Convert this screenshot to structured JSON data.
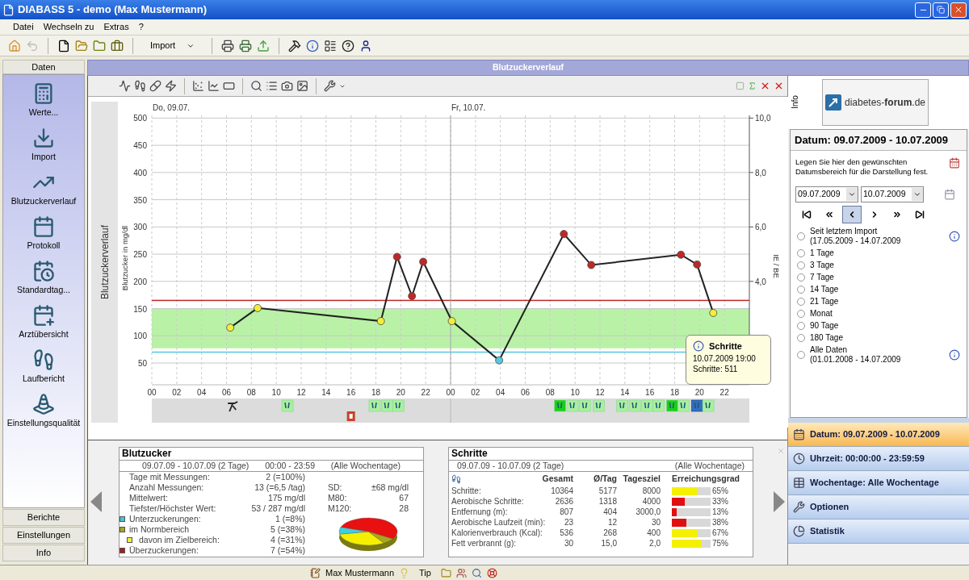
{
  "window": {
    "title": "DIABASS 5 - demo (Max Mustermann)"
  },
  "menu": [
    "Datei",
    "Wechseln zu",
    "Extras",
    "?"
  ],
  "toolbar": {
    "import_label": "Import"
  },
  "sidebar": {
    "header": "Daten",
    "items": [
      {
        "label": "Werte..."
      },
      {
        "label": "Import"
      },
      {
        "label": "Blutzuckerverlauf"
      },
      {
        "label": "Protokoll"
      },
      {
        "label": "Standardtag..."
      },
      {
        "label": "Arztübersicht"
      },
      {
        "label": "Laufbericht"
      },
      {
        "label": "Einstellungsqualität"
      }
    ],
    "sections": [
      "Berichte",
      "Einstellungen",
      "Info"
    ]
  },
  "panel": {
    "title": "Blutzuckerverlauf",
    "side_title": "Blutzuckerverlauf",
    "day_labels": [
      "Do, 09.07.",
      "Fr, 10.07."
    ],
    "chart_data": {
      "type": "line",
      "ylabel": "Blutzucker in mg/dl",
      "x": [
        6.3,
        8.5,
        18.4,
        19.7,
        20.9,
        21.8,
        24.1,
        27.9,
        33.1,
        35.3,
        42.5,
        43.8,
        45.1
      ],
      "series": [
        {
          "color": "#222222",
          "marker": "circle",
          "values": [
            115,
            151,
            127,
            245,
            173,
            236,
            127,
            55,
            287,
            230,
            249,
            231,
            142
          ]
        }
      ],
      "xlim": [
        0,
        48
      ],
      "ylim": [
        10,
        505
      ],
      "xticks": [
        {
          "value": 0,
          "label": "00"
        },
        {
          "value": 2,
          "label": "02"
        },
        {
          "value": 4,
          "label": "04"
        },
        {
          "value": 6,
          "label": "06"
        },
        {
          "value": 8,
          "label": "08"
        },
        {
          "value": 10,
          "label": "10"
        },
        {
          "value": 12,
          "label": "12"
        },
        {
          "value": 14,
          "label": "14"
        },
        {
          "value": 16,
          "label": "16"
        },
        {
          "value": 18,
          "label": "18"
        },
        {
          "value": 20,
          "label": "20"
        },
        {
          "value": 22,
          "label": "22"
        },
        {
          "value": 24,
          "label": "00"
        },
        {
          "value": 26,
          "label": "02"
        },
        {
          "value": 28,
          "label": "04"
        },
        {
          "value": 30,
          "label": "06"
        },
        {
          "value": 32,
          "label": "08"
        },
        {
          "value": 34,
          "label": "10"
        },
        {
          "value": 36,
          "label": "12"
        },
        {
          "value": 38,
          "label": "14"
        },
        {
          "value": 40,
          "label": "16"
        },
        {
          "value": 42,
          "label": "18"
        },
        {
          "value": 44,
          "label": "20"
        },
        {
          "value": 46,
          "label": "22"
        }
      ],
      "yticks": [
        50,
        100,
        150,
        200,
        250,
        300,
        350,
        400,
        450,
        500
      ],
      "y2label": "IE / BE",
      "y2lim": [
        0.2,
        10.1
      ],
      "y2ticks": [
        {
          "value": 4,
          "label": "4,0"
        },
        {
          "value": 6,
          "label": "6,0"
        },
        {
          "value": 8,
          "label": "8,0"
        },
        {
          "value": 10,
          "label": "10,0"
        }
      ],
      "grid": true,
      "bands": [
        {
          "axis": "y",
          "from": 77,
          "to": 150,
          "color": "#b9f2a6"
        }
      ],
      "ref_lines": [
        {
          "axis": "y",
          "value": 165,
          "color": "#c02828"
        },
        {
          "axis": "y",
          "value": 70,
          "color": "#55c8e4"
        },
        {
          "axis": "x",
          "value": 24,
          "color": "#a8a8a8"
        }
      ]
    },
    "tooltip": {
      "title": "Schritte",
      "lines": [
        "10.07.2009 19:00",
        "Schritte: 511"
      ]
    }
  },
  "blutzucker": {
    "title": "Blutzucker",
    "period": [
      "09.07.09 - 10.07.09 (2 Tage)",
      "00:00 - 23:59",
      "(Alle Wochentage)"
    ],
    "stats": [
      {
        "label": "Tage mit Messungen:",
        "value": "2 (=100%)"
      },
      {
        "label": "Anzahl Messungen:",
        "value": "13 (=6,5 /tag)"
      },
      {
        "label": "Mittelwert:",
        "value": "175 mg/dl"
      },
      {
        "label": "Tiefster/Höchster Wert:",
        "value": "53 / 287 mg/dl"
      }
    ],
    "extra": [
      {
        "label": "SD:",
        "value": "±68 mg/dl"
      },
      {
        "label": "M80:",
        "value": "67"
      },
      {
        "label": "M120:",
        "value": "28"
      }
    ],
    "legend": [
      {
        "label": "Unterzuckerungen:",
        "value": "1 (=8%)",
        "color": "#3cc8d8"
      },
      {
        "label": "im Normbereich",
        "value": "5 (=38%)",
        "color": "#a8a818",
        "children": [
          {
            "label": "davon im Zielbereich:",
            "value": "4 (=31%)",
            "color": "#f0f040"
          }
        ]
      },
      {
        "label": "Überzuckerungen:",
        "value": "7 (=54%)",
        "color": "#b01818"
      }
    ]
  },
  "schritte": {
    "title": "Schritte",
    "period": [
      "09.07.09 - 10.07.09 (2 Tage)",
      "(Alle Wochentage)"
    ],
    "columns": [
      "Gesamt",
      "Ø/Tag",
      "Tagesziel",
      "Erreichungsgrad"
    ],
    "rows": [
      {
        "label": "Schritte:",
        "values": [
          "10364",
          "5177",
          "8000"
        ],
        "level": 0.65,
        "color": "#f5f000",
        "percent": "65%"
      },
      {
        "label": "Aerobische Schritte:",
        "values": [
          "2636",
          "1318",
          "4000"
        ],
        "level": 0.33,
        "color": "#e01010",
        "percent": "33%"
      },
      {
        "label": "Entfernung (m):",
        "values": [
          "807",
          "404",
          "3000,0"
        ],
        "level": 0.13,
        "color": "#e01010",
        "percent": "13%"
      },
      {
        "label": "Aerobische Laufzeit (min):",
        "values": [
          "23",
          "12",
          "30"
        ],
        "level": 0.38,
        "color": "#e01010",
        "percent": "38%"
      },
      {
        "label": "Kalorienverbrauch (Kcal):",
        "values": [
          "536",
          "268",
          "400"
        ],
        "level": 0.67,
        "color": "#f5f000",
        "percent": "67%"
      },
      {
        "label": "Fett verbrannt (g):",
        "values": [
          "30",
          "15,0",
          "2,0"
        ],
        "level": 0.75,
        "color": "#f5f000",
        "percent": "75%"
      }
    ]
  },
  "date_panel": {
    "tab": "Info",
    "logo": "diabetes-**forum**.de",
    "title": "Datum: 09.07.2009 - 10.07.2009",
    "hint": "Legen Sie hier den gewünschten Datumsbereich für die Darstellung fest.",
    "from": "09.07.2009",
    "to": "10.07.2009",
    "nav": [
      {
        "selected": false
      },
      {
        "selected": false
      },
      {
        "selected": true
      },
      {
        "selected": false
      },
      {
        "selected": false
      },
      {
        "selected": false
      }
    ],
    "ranges": [
      {
        "label": "Seit letztem Import",
        "sub": "(17.05.2009 - 14.07.2009",
        "info": true,
        "selected": false
      },
      {
        "label": "1 Tage",
        "info": false,
        "selected": false
      },
      {
        "label": "3 Tage",
        "info": false,
        "selected": false
      },
      {
        "label": "7 Tage",
        "info": false,
        "selected": false
      },
      {
        "label": "14 Tage",
        "info": false,
        "selected": false
      },
      {
        "label": "21 Tage",
        "info": false,
        "selected": false
      },
      {
        "label": "Monat",
        "info": false,
        "selected": false
      },
      {
        "label": "90 Tage",
        "info": false,
        "selected": false
      },
      {
        "label": "180 Tage",
        "info": false,
        "selected": false
      },
      {
        "label": "Alle Daten",
        "sub": "(01.01.2008 - 14.07.2009",
        "info": true,
        "selected": false
      }
    ]
  },
  "accordion": [
    {
      "label": "Datum: 09.07.2009 - 10.07.2009",
      "selected": true
    },
    {
      "label": "Uhrzeit: 00:00:00 - 23:59:59",
      "selected": false
    },
    {
      "label": "Wochentage: Alle Wochentage",
      "selected": false
    },
    {
      "label": "Optionen",
      "selected": false
    },
    {
      "label": "Statistik",
      "selected": false
    }
  ],
  "status_bar": {
    "user": "Max Mustermann",
    "tip": "Tip"
  }
}
